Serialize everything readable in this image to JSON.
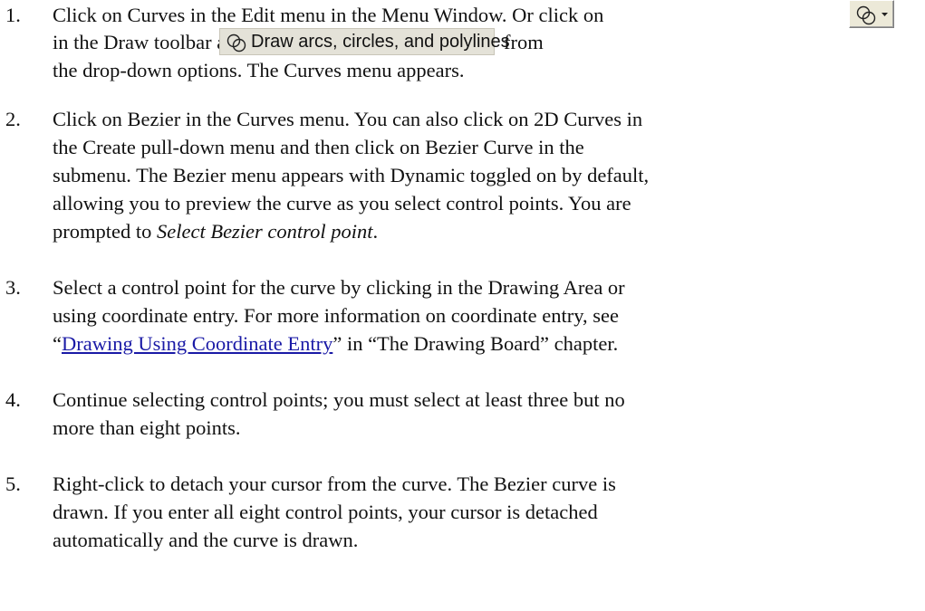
{
  "steps": [
    {
      "number": "1.",
      "line1": "Click on Curves in the Edit menu in the Menu Window. Or click on",
      "line2a": "in the Draw toolbar and select",
      "line2b": "from",
      "line3": "the drop-down options. The Curves menu appears."
    },
    {
      "number": "2.",
      "line1": "Click on Bezier in the Curves menu. You can also click on 2D Curves in",
      "line2": "the Create pull-down menu and then click on Bezier Curve in the",
      "line3": "submenu. The Bezier menu appears with Dynamic toggled on by default,",
      "line4": "allowing you to preview the curve as you select control points. You are",
      "line5_prefix": "prompted to ",
      "line5_italic": "Select Bezier control point",
      "line5_suffix": "."
    },
    {
      "number": "3.",
      "line1": "Select a control point for the curve by clicking in the Drawing Area or",
      "line2": "using coordinate entry. For more information on coordinate entry, see",
      "line3_open": "“",
      "line3_link": "Drawing Using Coordinate Entry",
      "line3_rest": "” in “The Drawing Board” chapter."
    },
    {
      "number": "4.",
      "line1": "Continue selecting control points; you must select at least three but no",
      "line2": "more than eight points."
    },
    {
      "number": "5.",
      "line1": "Right-click to detach your cursor from the curve. The Bezier curve is",
      "line2": "drawn. If you enter all eight control points, your cursor is detached",
      "line3": "automatically and the curve is drawn."
    }
  ],
  "toolbar_button": {
    "icon": "draw-circles-dropdown-icon"
  },
  "dropdown_option": {
    "label": "Draw arcs, circles, and polylines",
    "icon": "draw-circles-icon"
  },
  "colors": {
    "link": "#1a1aa6",
    "toolbar_bg": "#ece9d8"
  }
}
